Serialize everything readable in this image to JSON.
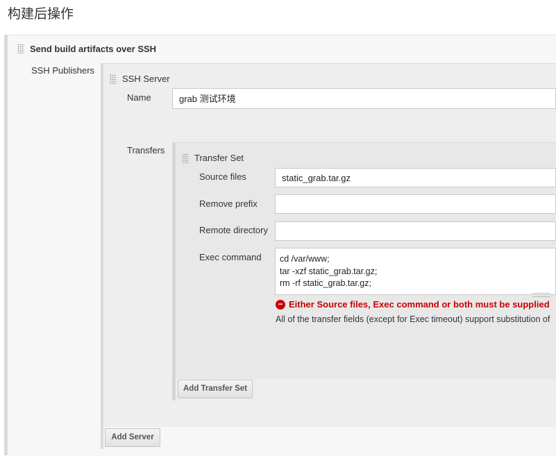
{
  "section": {
    "title": "构建后操作"
  },
  "publisher": {
    "title": "Send build artifacts over SSH",
    "label": "SSH Publishers",
    "server": {
      "title": "SSH Server",
      "name_label": "Name",
      "name_value": "grab 测试环境",
      "transfers_label": "Transfers",
      "transfer_set": {
        "title": "Transfer Set",
        "source_files_label": "Source files",
        "source_files_value": "static_grab.tar.gz",
        "remove_prefix_label": "Remove prefix",
        "remove_prefix_value": "",
        "remote_directory_label": "Remote directory",
        "remote_directory_value": "",
        "exec_command_label": "Exec command",
        "exec_command_lines": [
          "cd /var/www;",
          "tar -xzf static_grab.tar.gz;",
          "rm -rf static_grab.tar.gz;"
        ],
        "error_icon_glyph": "−",
        "error_message": "Either Source files, Exec command or both must be supplied",
        "help_text": "All of the transfer fields (except for Exec timeout) support substitution of"
      },
      "add_transfer_set_label": "Add Transfer Set"
    },
    "add_server_label": "Add Server"
  },
  "colors": {
    "error": "#cc0000",
    "panel": "#eeeeee",
    "inner_panel": "#e8e8e8"
  }
}
